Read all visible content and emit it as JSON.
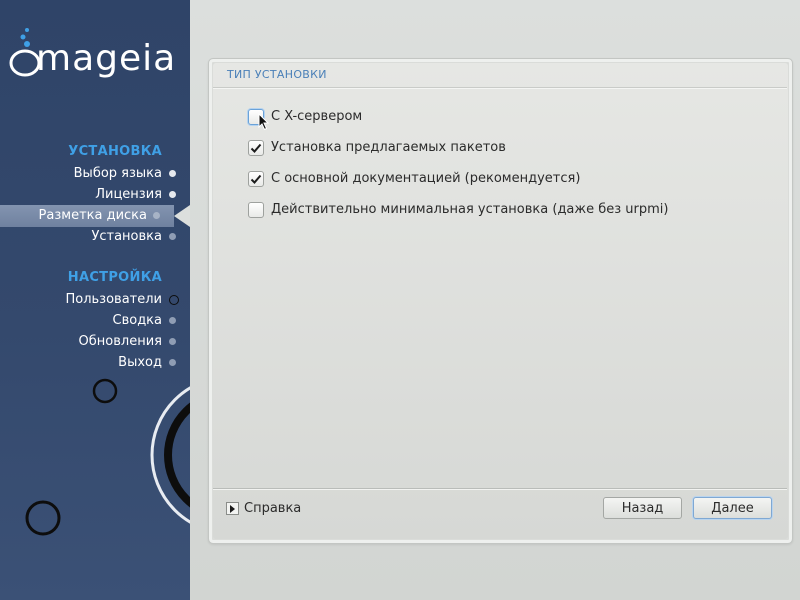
{
  "app": {
    "brand": "mageia"
  },
  "sidebar": {
    "sections": [
      {
        "title": "УСТАНОВКА",
        "steps": [
          {
            "label": "Выбор языка",
            "state": "done"
          },
          {
            "label": "Лицензия",
            "state": "done"
          },
          {
            "label": "Разметка диска",
            "state": "active"
          },
          {
            "label": "Установка",
            "state": "pending"
          }
        ]
      },
      {
        "title": "НАСТРОЙКА",
        "steps": [
          {
            "label": "Пользователи",
            "state": "pending"
          },
          {
            "label": "Сводка",
            "state": "pending"
          },
          {
            "label": "Обновления",
            "state": "pending"
          },
          {
            "label": "Выход",
            "state": "pending"
          }
        ]
      }
    ]
  },
  "panel": {
    "title": "ТИП УСТАНОВКИ",
    "options": [
      {
        "label": "С X-сервером",
        "checked": false,
        "focused": true
      },
      {
        "label": "Установка предлагаемых пакетов",
        "checked": true
      },
      {
        "label": "С основной документацией (рекомендуется)",
        "checked": true
      },
      {
        "label": "Действительно минимальная установка (даже без urpmi)",
        "checked": false
      }
    ],
    "help_label": "Справка",
    "back_label": "Назад",
    "next_label": "Далее"
  },
  "colors": {
    "sidebar_bg": "#34496d",
    "section_title": "#3fa0e6",
    "panel_title": "#4a7fb8",
    "window_bg": "#d8dbd8"
  },
  "icons": {
    "logo": "mageia-cauldron-logo",
    "check": "checkmark-icon",
    "help_toggle": "triangle-right-icon",
    "cursor": "mouse-pointer-icon"
  }
}
